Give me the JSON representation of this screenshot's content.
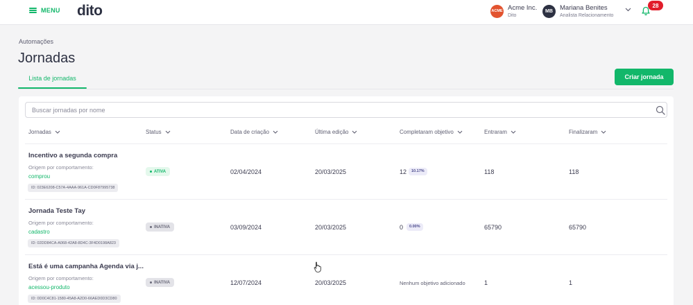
{
  "topbar": {
    "menu_label": "MENU",
    "logo": "dito",
    "company": {
      "badge": "ACME",
      "name": "Acme Inc.",
      "sub": "Dito"
    },
    "user": {
      "initials": "MB",
      "name": "Mariana Benites",
      "role": "Analista Relacionamento"
    },
    "notifications": "28",
    "icons": {
      "menu": "hamburger-icon",
      "chevron": "chevron-down-icon",
      "bell": "bell-icon"
    }
  },
  "page": {
    "breadcrumb": "Automações",
    "title": "Jornadas",
    "tab": "Lista de jornadas",
    "create_button": "Criar jornada"
  },
  "search": {
    "placeholder": "Buscar jornadas por nome"
  },
  "columns": [
    "Jornadas",
    "Status",
    "Data de criação",
    "Última edição",
    "Completaram objetivo",
    "Entraram",
    "Finalizaram"
  ],
  "rows": [
    {
      "name": "Incentivo a segunda compra",
      "origin": "Origem por comportamento:",
      "trigger": "comprou",
      "id": "ID: 023E6208-C57A-4AAA-961A-CD0F87995738",
      "status": "ATIVA",
      "created": "02/04/2024",
      "edited": "20/03/2025",
      "completed": "12",
      "completed_pct": "10.17%",
      "entered": "118",
      "finished": "118"
    },
    {
      "name": "Jornada Teste Tay",
      "origin": "Origem por comportamento:",
      "trigger": "cadastro",
      "id": "ID: 02DD84CA-A068-42A8-8D4C-3F4D0198A823",
      "status": "INATIVA",
      "created": "03/09/2024",
      "edited": "20/03/2025",
      "completed": "0",
      "completed_pct": "0.00%",
      "entered": "65790",
      "finished": "65790"
    },
    {
      "name": "Está é uma campanha Agenda via j...",
      "origin": "Origem por comportamento:",
      "trigger": "acessou-produto",
      "id": "ID: 0D0C4C81-1580-45A8-A2D0-66AED0D3CD80",
      "status": "INATIVA",
      "created": "12/07/2024",
      "edited": "20/03/2025",
      "completed_text": "Nenhum objetivo adicionado",
      "entered": "1",
      "finished": "1"
    }
  ],
  "colors": {
    "accent": "#12b76a",
    "danger": "#e11d2b",
    "dark": "#2d3142"
  }
}
